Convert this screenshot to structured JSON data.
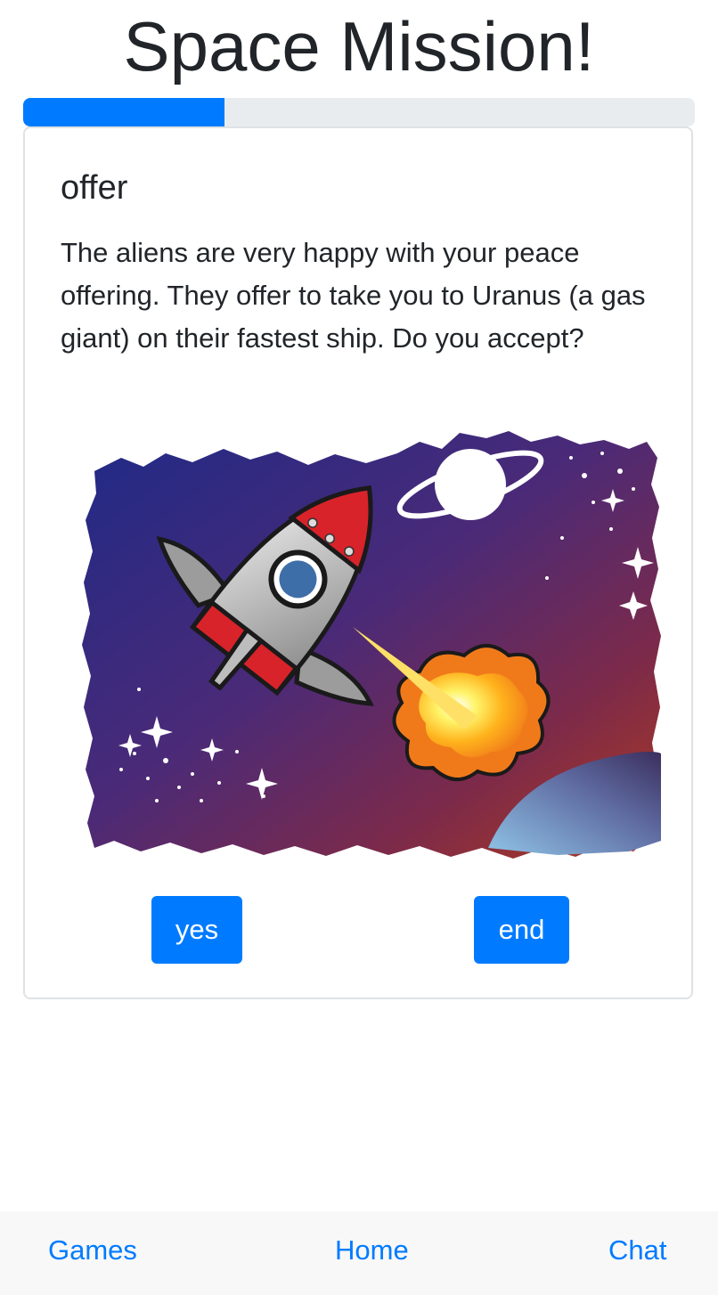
{
  "header": {
    "title": "Space Mission!"
  },
  "progress": {
    "fraction": 0.3,
    "color": "#007bff"
  },
  "card": {
    "heading": "offer",
    "text": "The aliens are very happy with your peace offering. They offer to take you to Uranus (a gas giant) on their fastest ship. Do you accept?",
    "illustration": "rocket-in-space-illustration",
    "buttons": {
      "yes_label": "yes",
      "end_label": "end"
    }
  },
  "bottom_nav": {
    "games": "Games",
    "home": "Home",
    "chat": "Chat"
  },
  "colors": {
    "accent": "#007bff",
    "text": "#212529",
    "track": "#e9ecef"
  }
}
